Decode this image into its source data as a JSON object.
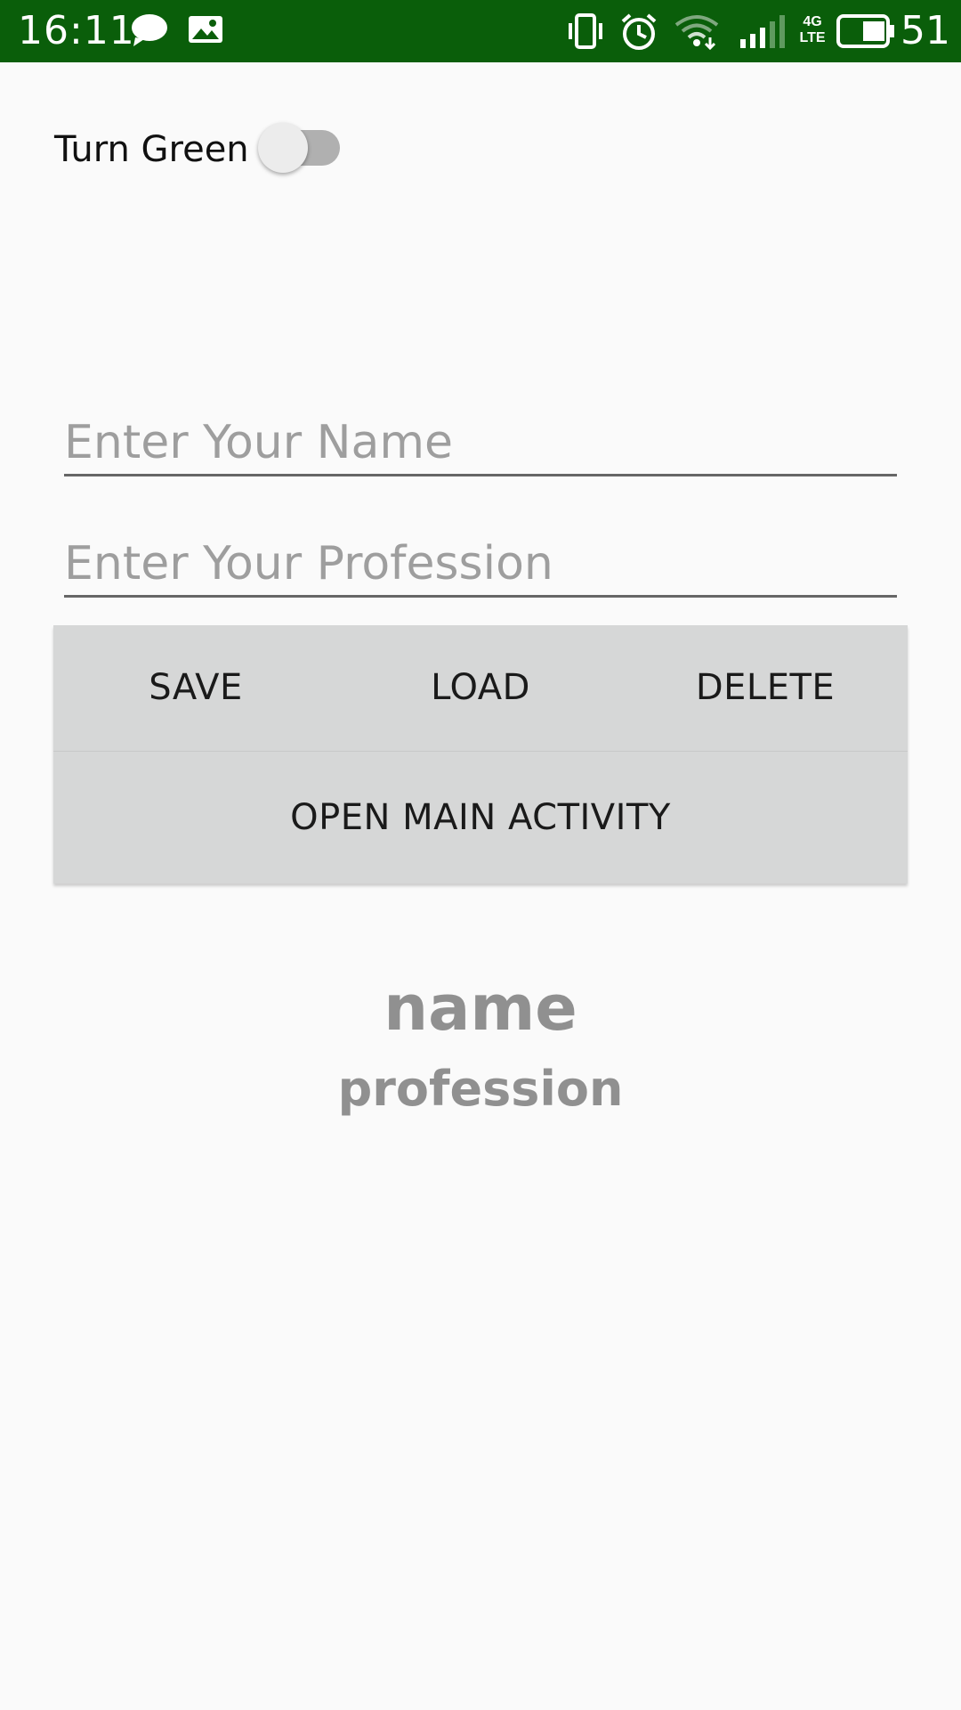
{
  "status_bar": {
    "time": "16:11",
    "battery_percent": "51",
    "network_label": "4G LTE",
    "icons": [
      "message-icon",
      "image-icon",
      "vibrate-icon",
      "alarm-icon",
      "wifi-icon",
      "signal-icon",
      "battery-icon"
    ],
    "background_color": "#0a5e0a"
  },
  "toggle": {
    "label": "Turn Green",
    "checked": false
  },
  "inputs": {
    "name": {
      "value": "",
      "placeholder": "Enter Your Name"
    },
    "profession": {
      "value": "",
      "placeholder": "Enter Your Profession"
    }
  },
  "buttons": {
    "save": "SAVE",
    "load": "LOAD",
    "delete": "DELETE",
    "open_main": "OPEN MAIN ACTIVITY"
  },
  "result": {
    "name": "name",
    "profession": "profession"
  }
}
